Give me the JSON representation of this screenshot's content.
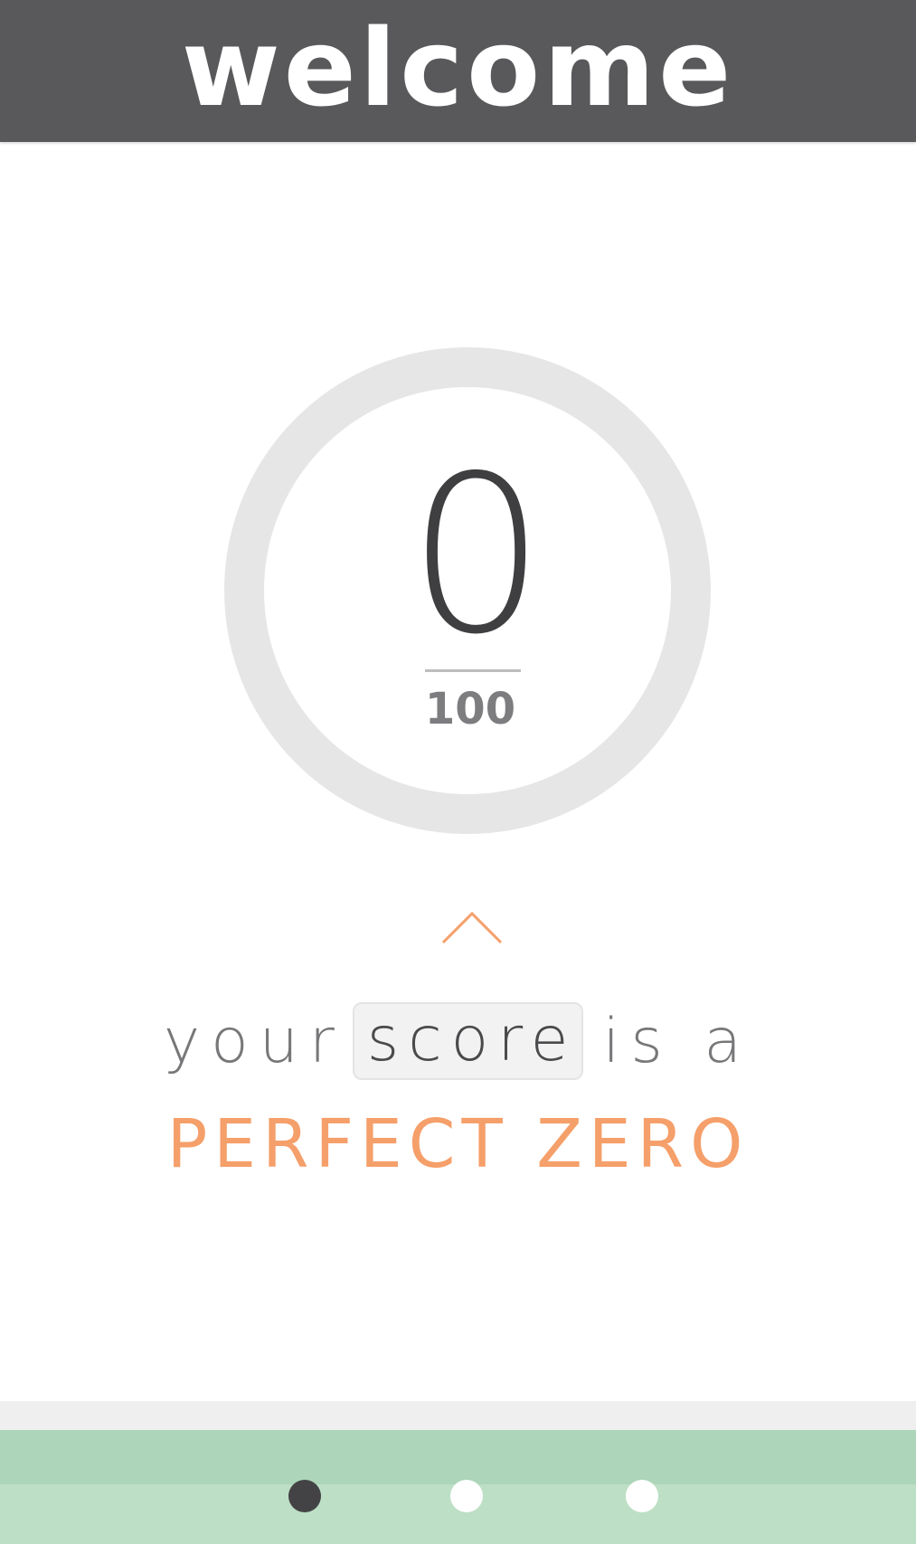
{
  "header": {
    "title": "welcome"
  },
  "score": {
    "value": "0",
    "max": "100",
    "progress_fraction": 0,
    "ring_color": "#e6e6e6"
  },
  "caption": {
    "prefix": "your",
    "highlight": "score",
    "suffix": "is a"
  },
  "result": {
    "label": "PERFECT ZERO",
    "color": "#f59f6a"
  },
  "icons": {
    "chevron": "chevron-up-icon"
  },
  "pager": {
    "page_count": 3,
    "active_index": 0,
    "colors": {
      "active": "#434345",
      "inactive": "#ffffff",
      "background": "#acd5b9"
    }
  }
}
